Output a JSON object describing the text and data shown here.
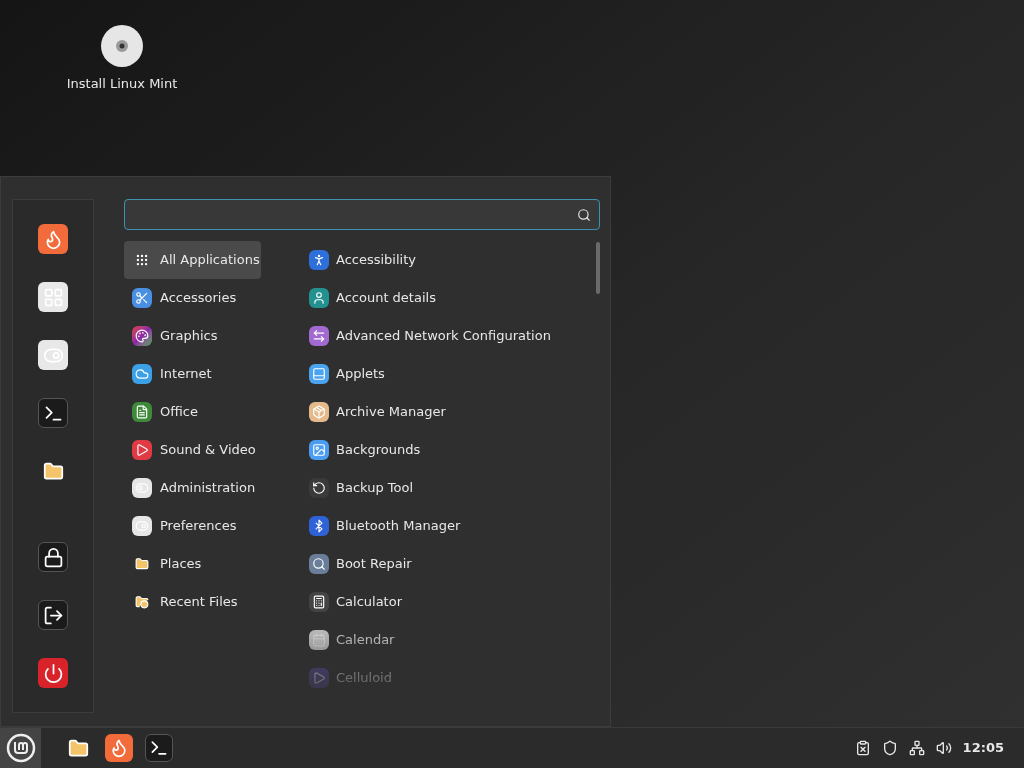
{
  "desktop_icons": [
    {
      "label": "Install Linux Mint"
    }
  ],
  "menu": {
    "categories": [
      {
        "label": "All Applications",
        "selected": true
      },
      {
        "label": "Accessories",
        "selected": false
      },
      {
        "label": "Graphics",
        "selected": false
      },
      {
        "label": "Internet",
        "selected": false
      },
      {
        "label": "Office",
        "selected": false
      },
      {
        "label": "Sound & Video",
        "selected": false
      },
      {
        "label": "Administration",
        "selected": false
      },
      {
        "label": "Preferences",
        "selected": false
      },
      {
        "label": "Places",
        "selected": false
      },
      {
        "label": "Recent Files",
        "selected": false
      }
    ],
    "applications": [
      {
        "label": "Accessibility"
      },
      {
        "label": "Account details"
      },
      {
        "label": "Advanced Network Configuration"
      },
      {
        "label": "Applets"
      },
      {
        "label": "Archive Manager"
      },
      {
        "label": "Backgrounds"
      },
      {
        "label": "Backup Tool"
      },
      {
        "label": "Bluetooth Manager"
      },
      {
        "label": "Boot Repair"
      },
      {
        "label": "Calculator"
      },
      {
        "label": "Calendar"
      },
      {
        "label": "Celluloid"
      }
    ]
  },
  "taskbar": {
    "clock": "12:05"
  }
}
